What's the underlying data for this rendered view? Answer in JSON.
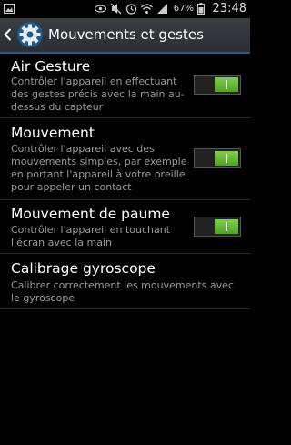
{
  "status_bar": {
    "battery_text": "67%",
    "time": "23:48",
    "icons": [
      "gallery-icon",
      "eye-icon",
      "mute-icon",
      "alarm-icon",
      "wifi-icon",
      "signal-icon",
      "battery-icon"
    ]
  },
  "action_bar": {
    "title": "Mouvements et gestes"
  },
  "settings": [
    {
      "title": "Air Gesture",
      "summary": "Contrôler l'appareil en effectuant des gestes précis avec la main au-dessus du capteur",
      "toggle": "on"
    },
    {
      "title": "Mouvement",
      "summary": "Contrôler l'appareil avec des mouvements simples, par exemple en portant l'appareil à votre oreille pour appeler un contact",
      "toggle": "on"
    },
    {
      "title": "Mouvement de paume",
      "summary": "Contrôler l'appareil en touchant l'écran avec la main",
      "toggle": "on"
    },
    {
      "title": "Calibrage gyroscope",
      "summary": "Calibrer correctement les mouvements avec le gyroscope"
    }
  ],
  "colors": {
    "accent_divider": "#1d5f8a",
    "toggle_on": "#5dbb31"
  }
}
